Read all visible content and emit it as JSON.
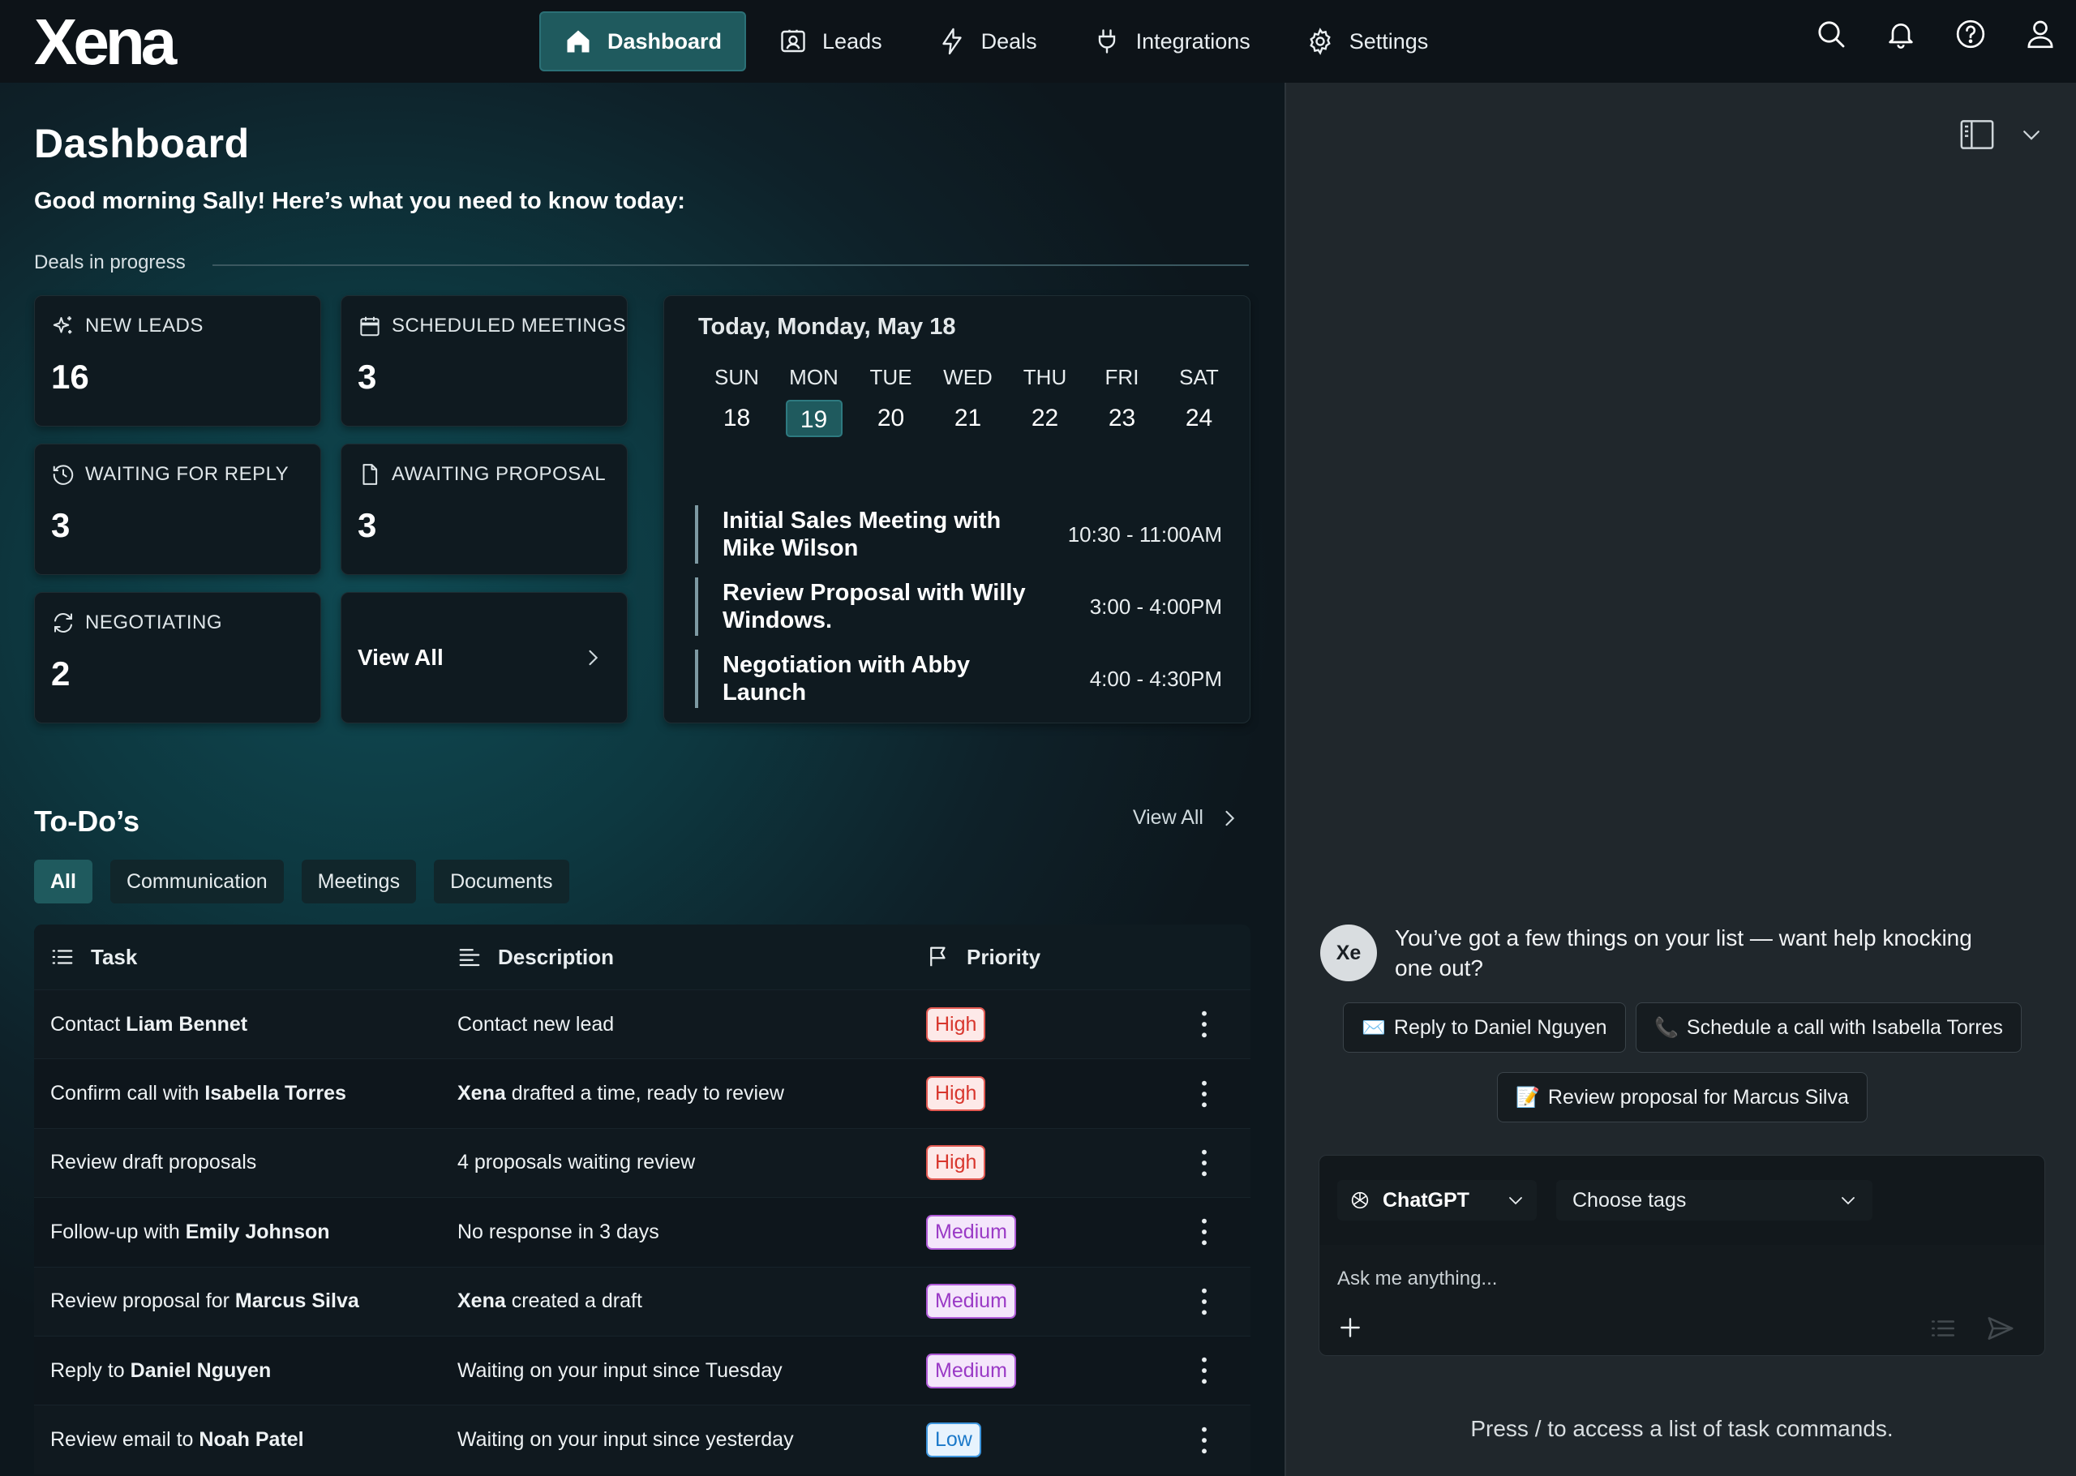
{
  "brand": {
    "logo": "Xena"
  },
  "nav": {
    "items": [
      {
        "label": "Dashboard",
        "icon": "home-icon",
        "active": true
      },
      {
        "label": "Leads",
        "icon": "contact-card-icon",
        "active": false
      },
      {
        "label": "Deals",
        "icon": "lightning-icon",
        "active": false
      },
      {
        "label": "Integrations",
        "icon": "plug-icon",
        "active": false
      },
      {
        "label": "Settings",
        "icon": "gear-icon",
        "active": false
      }
    ],
    "right_icons": [
      "search-icon",
      "bell-icon",
      "help-icon",
      "user-icon"
    ]
  },
  "dashboard": {
    "title": "Dashboard",
    "greeting": "Good morning Sally! Here’s what you need to know today:",
    "section_label": "Deals in progress",
    "stats": [
      {
        "label": "NEW LEADS",
        "value": "16",
        "icon": "sparkle-icon"
      },
      {
        "label": "SCHEDULED MEETINGS",
        "value": "3",
        "icon": "calendar-icon"
      },
      {
        "label": "WAITING FOR REPLY",
        "value": "3",
        "icon": "clock-icon"
      },
      {
        "label": "AWAITING PROPOSAL",
        "value": "3",
        "icon": "document-icon"
      },
      {
        "label": "NEGOTIATING",
        "value": "2",
        "icon": "refresh-icon"
      }
    ],
    "view_all": "View All"
  },
  "calendar": {
    "title": "Today, Monday, May 18",
    "days": [
      {
        "dow": "SUN",
        "num": "18",
        "today": false
      },
      {
        "dow": "MON",
        "num": "19",
        "today": true
      },
      {
        "dow": "TUE",
        "num": "20",
        "today": false
      },
      {
        "dow": "WED",
        "num": "21",
        "today": false
      },
      {
        "dow": "THU",
        "num": "22",
        "today": false
      },
      {
        "dow": "FRI",
        "num": "23",
        "today": false
      },
      {
        "dow": "SAT",
        "num": "24",
        "today": false
      }
    ],
    "events": [
      {
        "title": "Initial Sales Meeting with Mike Wilson",
        "time": "10:30 - 11:00AM"
      },
      {
        "title": "Review Proposal with Willy Windows.",
        "time": "3:00 - 4:00PM"
      },
      {
        "title": "Negotiation with Abby Launch",
        "time": "4:00 - 4:30PM"
      }
    ]
  },
  "todos": {
    "title": "To-Do’s",
    "view_all": "View All",
    "filters": [
      {
        "label": "All",
        "active": true
      },
      {
        "label": "Communication",
        "active": false
      },
      {
        "label": "Meetings",
        "active": false
      },
      {
        "label": "Documents",
        "active": false
      }
    ],
    "columns": {
      "task": "Task",
      "description": "Description",
      "priority": "Priority"
    },
    "rows": [
      {
        "task_prefix": "Contact ",
        "task_name": "Liam Bennet",
        "desc_bold": "",
        "desc": "Contact new lead",
        "priority": "High",
        "level": "high"
      },
      {
        "task_prefix": "Confirm call with ",
        "task_name": "Isabella Torres",
        "desc_bold": "Xena",
        "desc": " drafted a time, ready to review",
        "priority": "High",
        "level": "high"
      },
      {
        "task_prefix": "Review draft proposals",
        "task_name": "",
        "desc_bold": "",
        "desc": "4 proposals waiting review",
        "priority": "High",
        "level": "high"
      },
      {
        "task_prefix": "Follow-up with ",
        "task_name": "Emily Johnson",
        "desc_bold": "",
        "desc": "No response in 3 days",
        "priority": "Medium",
        "level": "medium"
      },
      {
        "task_prefix": "Review proposal for ",
        "task_name": "Marcus Silva",
        "desc_bold": "Xena",
        "desc": " created a draft",
        "priority": "Medium",
        "level": "medium"
      },
      {
        "task_prefix": "Reply to ",
        "task_name": "Daniel Nguyen",
        "desc_bold": "",
        "desc": "Waiting on your input since Tuesday",
        "priority": "Medium",
        "level": "medium"
      },
      {
        "task_prefix": "Review email to ",
        "task_name": "Noah Patel",
        "desc_bold": "",
        "desc": "Waiting on your input since yesterday",
        "priority": "Low",
        "level": "low"
      }
    ]
  },
  "assistant": {
    "avatar": "Xe",
    "message": "You’ve got a few things on your list — want help knocking one out?",
    "suggestions": [
      {
        "emoji": "✉️",
        "label": "Reply to Daniel Nguyen"
      },
      {
        "emoji": "📞",
        "label": "Schedule a call with Isabella Torres"
      },
      {
        "emoji": "📝",
        "label": "Review proposal for Marcus Silva"
      }
    ],
    "model": "ChatGPT",
    "tags_placeholder": "Choose tags",
    "input_placeholder": "Ask me anything...",
    "hint": "Press / to access a list of task commands."
  },
  "colors": {
    "accent": "#1f5a5e",
    "high": "#d8362d",
    "medium": "#9a3ac6",
    "low": "#1b79c9"
  }
}
